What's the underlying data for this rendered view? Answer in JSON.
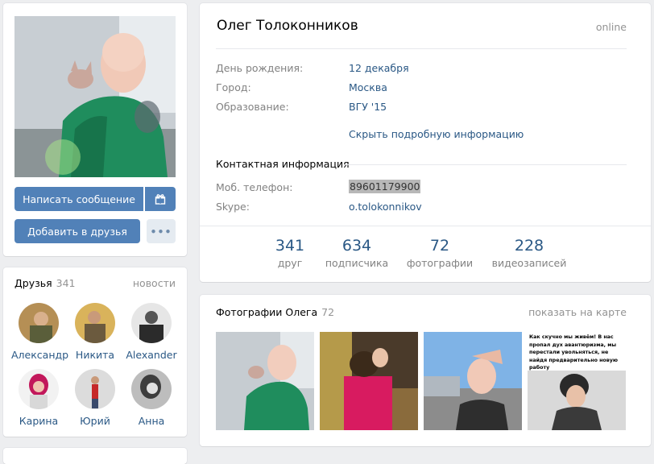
{
  "profile": {
    "name": "Олег Толоконников",
    "status": "online",
    "info": [
      {
        "label": "День рождения:",
        "value": "12 декабря"
      },
      {
        "label": "Город:",
        "value": "Москва"
      },
      {
        "label": "Образование:",
        "value": "ВГУ '15"
      }
    ],
    "hide_link": "Скрыть подробную информацию",
    "contacts_title": "Контактная информация",
    "contacts": [
      {
        "label": "Моб. телефон:",
        "value": "89601179900"
      },
      {
        "label": "Skype:",
        "value": "o.tolokonnikov"
      }
    ],
    "counters": [
      {
        "num": "341",
        "label": "друг"
      },
      {
        "num": "634",
        "label": "подписчика"
      },
      {
        "num": "72",
        "label": "фотографии"
      },
      {
        "num": "228",
        "label": "видеозаписей"
      }
    ]
  },
  "actions": {
    "message": "Написать сообщение",
    "add_friend": "Добавить в друзья",
    "more": "•••"
  },
  "friends": {
    "title": "Друзья",
    "count": "341",
    "link": "новости",
    "items": [
      {
        "name": "Александр"
      },
      {
        "name": "Никита"
      },
      {
        "name": "Alexander"
      },
      {
        "name": "Карина"
      },
      {
        "name": "Юрий"
      },
      {
        "name": "Анна"
      }
    ]
  },
  "photos": {
    "title": "Фотографии Олега",
    "count": "72",
    "link": "показать на карте",
    "meme_text": "Как скучно мы живём! В нас пропал дух авантюризма, мы перестали увольняться, не найдя предварительно новую работу"
  },
  "colors": {
    "accent": "#5181b8",
    "link": "#2a5885",
    "muted": "#828282",
    "background": "#edeef0"
  }
}
